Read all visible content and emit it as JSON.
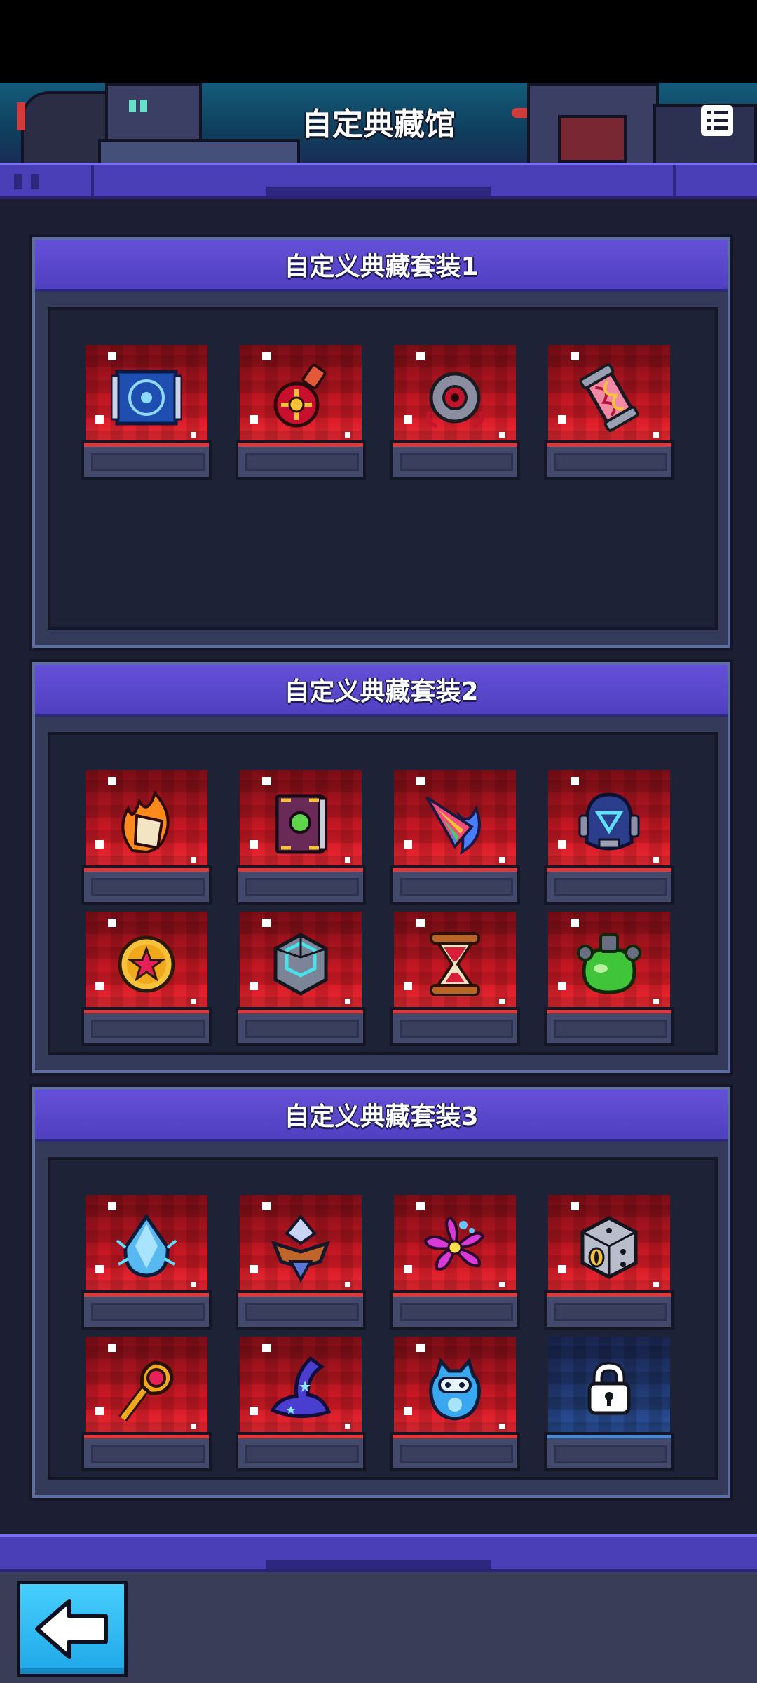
{
  "header": {
    "title": "自定典藏馆",
    "menu_icon": "list-menu-icon"
  },
  "sets": [
    {
      "title": "自定义典藏套装1",
      "items": [
        {
          "icon": "blueprint-map-icon",
          "locked": false
        },
        {
          "icon": "red-potion-flask-icon",
          "locked": false
        },
        {
          "icon": "mechanical-eye-orb-icon",
          "locked": false
        },
        {
          "icon": "dna-capsule-icon",
          "locked": false
        }
      ]
    },
    {
      "title": "自定义典藏套装2",
      "items": [
        {
          "icon": "flaming-scroll-icon",
          "locked": false
        },
        {
          "icon": "spell-book-icon",
          "locked": false
        },
        {
          "icon": "rainbow-unicorn-horn-icon",
          "locked": false
        },
        {
          "icon": "robot-helmet-icon",
          "locked": false
        },
        {
          "icon": "star-coin-icon",
          "locked": false
        },
        {
          "icon": "crystal-cube-icon",
          "locked": false
        },
        {
          "icon": "hourglass-icon",
          "locked": false
        },
        {
          "icon": "green-slime-goggles-icon",
          "locked": false
        }
      ]
    },
    {
      "title": "自定义典藏套装3",
      "items": [
        {
          "icon": "ice-crystal-gem-icon",
          "locked": false
        },
        {
          "icon": "crowned-gem-icon",
          "locked": false
        },
        {
          "icon": "magic-flower-icon",
          "locked": false
        },
        {
          "icon": "monster-dice-icon",
          "locked": false
        },
        {
          "icon": "ruby-staff-icon",
          "locked": false
        },
        {
          "icon": "wizard-hat-icon",
          "locked": false
        },
        {
          "icon": "ice-robot-pet-icon",
          "locked": false
        },
        {
          "icon": "lock-icon",
          "locked": true
        }
      ]
    }
  ],
  "footer": {
    "back_icon": "back-arrow-icon"
  }
}
